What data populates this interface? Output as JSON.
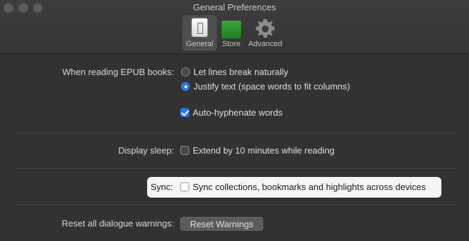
{
  "window": {
    "title": "General Preferences"
  },
  "toolbar": {
    "tabs": [
      {
        "label": "General",
        "icon": "general-icon",
        "selected": true
      },
      {
        "label": "Store",
        "icon": "store-icon",
        "selected": false
      },
      {
        "label": "Advanced",
        "icon": "gear-icon",
        "selected": false
      }
    ]
  },
  "epub": {
    "label": "When reading EPUB books:",
    "options": [
      {
        "label": "Let lines break naturally",
        "checked": false
      },
      {
        "label": "Justify text (space words to fit columns)",
        "checked": true
      }
    ],
    "hyphenate": {
      "label": "Auto-hyphenate words",
      "checked": true
    }
  },
  "display_sleep": {
    "label": "Display sleep:",
    "option": {
      "label": "Extend by 10 minutes while reading",
      "checked": false
    }
  },
  "sync": {
    "label": "Sync:",
    "option": {
      "label": "Sync collections, bookmarks and highlights across devices",
      "checked": false
    }
  },
  "reset": {
    "label": "Reset all dialogue warnings:",
    "button_label": "Reset Warnings"
  },
  "colors": {
    "accent": "#2b78e4",
    "background": "#323232",
    "highlight": "#f5f5f5"
  }
}
